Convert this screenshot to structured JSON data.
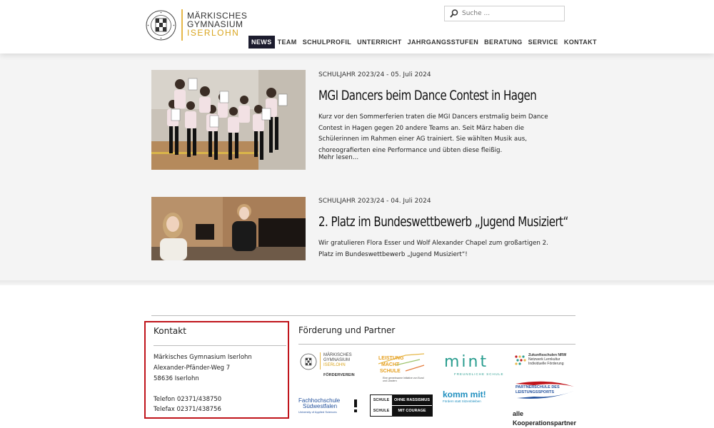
{
  "header": {
    "logo": {
      "line1": "MÄRKISCHES",
      "line2": "GYMNASIUM",
      "line3": "ISERLOHN",
      "seal_text": "LYCEUM ISERLOHNENSE"
    },
    "search": {
      "placeholder": "Suche ..."
    },
    "nav": [
      {
        "label": "NEWS",
        "active": true
      },
      {
        "label": "TEAM"
      },
      {
        "label": "SCHULPROFIL"
      },
      {
        "label": "UNTERRICHT"
      },
      {
        "label": "JAHRGANGSSTUFEN"
      },
      {
        "label": "BERATUNG"
      },
      {
        "label": "SERVICE"
      },
      {
        "label": "KONTAKT"
      }
    ]
  },
  "articles": [
    {
      "meta": "SCHULJAHR 2023/24 - 05. Juli 2024",
      "title": "MGI Dancers beim Dance Contest in Hagen",
      "text": "Kurz vor den Sommerferien traten die MGI Dancers erstmalig beim Dance Contest in Hagen gegen 20 andere Teams an. Seit März haben die Schülerinnen im Rahmen einer AG trainiert. Sie wählten Musik aus, choreografierten eine Performance und übten diese fleißig.",
      "more": "Mehr lesen...",
      "image_alt": "dance group photo"
    },
    {
      "meta": "SCHULJAHR 2023/24 - 04. Juli 2024",
      "title": "2. Platz im Bundeswettbewerb „Jugend Musiziert“",
      "text": "Wir gratulieren Flora Esser und Wolf Alexander Chapel zum großartigen 2. Platz im Bundeswettbewerb „Jugend Musiziert“!",
      "image_alt": "two students photo"
    }
  ],
  "footer": {
    "kontakt": {
      "title": "Kontakt",
      "lines": [
        "Märkisches Gymnasium Iserlohn",
        "Alexander-Pfänder-Weg 7",
        "58636 Iserlohn"
      ],
      "phone": "Telefon 02371/438750",
      "fax": "Telefax  02371/438756"
    },
    "partner": {
      "title": "Förderung und Partner",
      "logos": {
        "foerderverein": {
          "l1": "MÄRKISCHES",
          "l2": "GYMNASIUM",
          "l3": "ISERLOHN",
          "sub": "FÖRDERVEREIN"
        },
        "leistung": {
          "l1": "LEISTUNG",
          "l2": "MACHT",
          "l3": "SCHULE",
          "sub": "Eine gemeinsame Initiative von Bund und Ländern"
        },
        "mint": {
          "main": "mint",
          "sub": "FREUNDLICHE SCHULE"
        },
        "zukunft": {
          "l1": "Zukunftsschulen NRW",
          "l2": "Netzwerk Lernkultur",
          "l3": "Individuelle Förderung"
        },
        "fh": {
          "l1": "Fachhochschule",
          "l2": "Südwestfalen",
          "sub": "University of Applied Sciences"
        },
        "rassismus": {
          "a1": "SCHULE",
          "a2": "OHNE RASSISMUS",
          "b1": "SCHULE",
          "b2": "MIT COURAGE"
        },
        "kommmit": {
          "main": "komm mit!",
          "sub": "Fördern statt Sitzenbleiben"
        },
        "leistungssport": {
          "l1": "PARTNERSCHULE DES",
          "l2": "LEISTUNGSSPORTS"
        }
      },
      "alle_line1": "alle",
      "alle_line2": "Kooperationspartner"
    }
  },
  "colors": {
    "nav_active_bg": "#1c1c2e",
    "logo_accent": "#d9a520",
    "kontakt_border": "#c0141b",
    "mint_green": "#2a9d8f"
  }
}
